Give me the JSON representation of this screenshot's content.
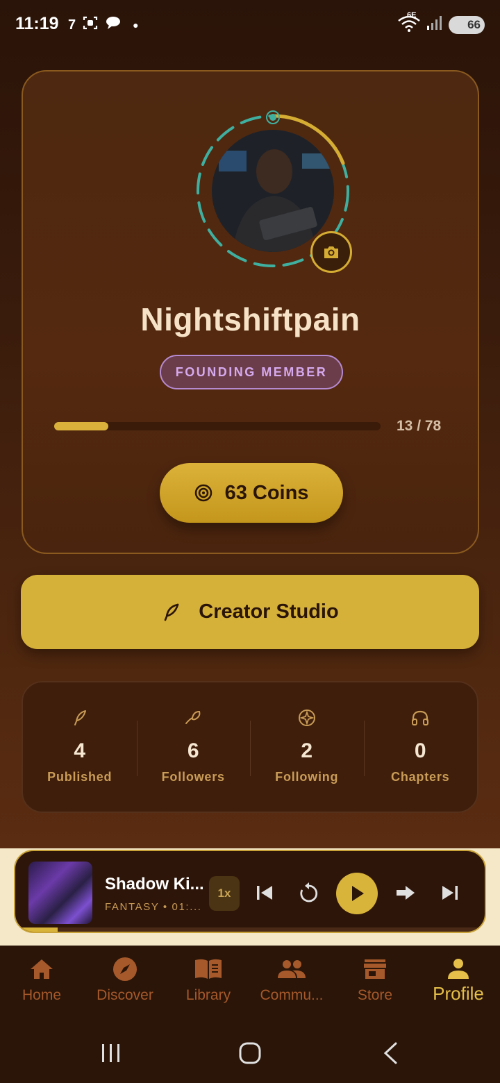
{
  "status_bar": {
    "time": "11:19",
    "network": "6E",
    "battery": "66"
  },
  "profile": {
    "username": "Nightshiftpain",
    "badge": "FOUNDING MEMBER",
    "progress": {
      "current": 13,
      "total": 78,
      "text": "13 / 78"
    },
    "coins_label": "63 Coins"
  },
  "creator_studio": {
    "label": "Creator Studio"
  },
  "stats": [
    {
      "icon": "quill-icon",
      "value": "4",
      "label": "Published"
    },
    {
      "icon": "feather-icon",
      "value": "6",
      "label": "Followers"
    },
    {
      "icon": "compass-star-icon",
      "value": "2",
      "label": "Following"
    },
    {
      "icon": "headphones-icon",
      "value": "0",
      "label": "Chapters"
    }
  ],
  "player": {
    "title": "Shadow Ki...",
    "meta": "FANTASY • 01:...",
    "speed": "1x",
    "progress_fraction": 0.09
  },
  "nav": [
    {
      "icon": "home-icon",
      "label": "Home",
      "active": false
    },
    {
      "icon": "compass-icon",
      "label": "Discover",
      "active": false
    },
    {
      "icon": "library-icon",
      "label": "Library",
      "active": false
    },
    {
      "icon": "community-icon",
      "label": "Commu...",
      "active": false
    },
    {
      "icon": "store-icon",
      "label": "Store",
      "active": false
    },
    {
      "icon": "profile-icon",
      "label": "Profile",
      "active": true
    }
  ],
  "colors": {
    "accent": "#d8b43a",
    "background": "#2a1508",
    "badge": "#b68ad0",
    "teal": "#3fb0a0"
  }
}
